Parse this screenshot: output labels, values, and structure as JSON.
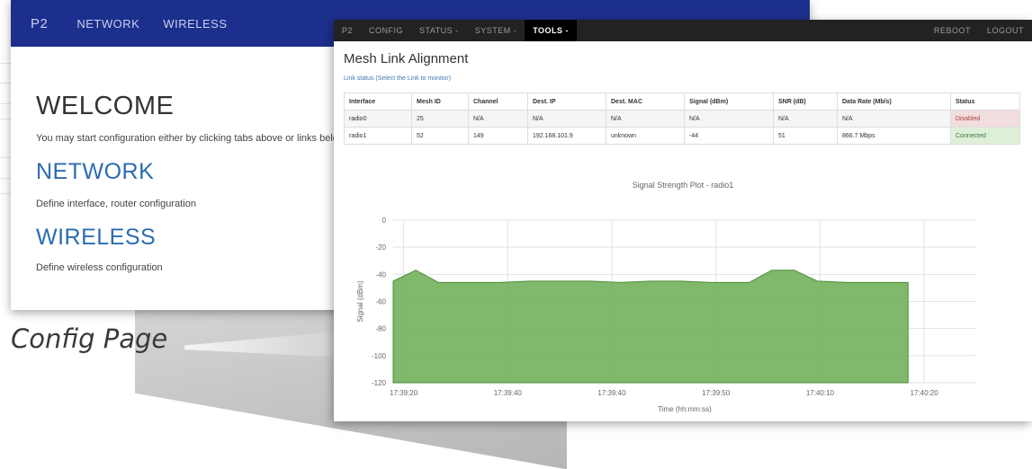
{
  "caption": "Config Page",
  "config_window": {
    "nav": {
      "brand": "P2",
      "items": [
        "NETWORK",
        "WIRELESS"
      ]
    },
    "welcome_title": "WELCOME",
    "welcome_text": "You may start configuration either by clicking tabs above or links below",
    "sections": [
      {
        "title": "NETWORK",
        "text": "Define interface, router configuration"
      },
      {
        "title": "WIRELESS",
        "text": "Define wireless configuration"
      }
    ]
  },
  "tools_window": {
    "nav": {
      "brand": "P2",
      "items": [
        "CONFIG",
        "STATUS -",
        "SYSTEM -",
        "TOOLS -"
      ],
      "active": "TOOLS -",
      "right_items": [
        "REBOOT",
        "LOGOUT"
      ]
    },
    "title": "Mesh Link Alignment",
    "hint": "Link status (Select the Link to monitor)",
    "table": {
      "headers": [
        "Interface",
        "Mesh ID",
        "Channel",
        "Dest. IP",
        "Dest. MAC",
        "Signal (dBm)",
        "SNR (dB)",
        "Data Rate (Mb/s)",
        "Status"
      ],
      "rows": [
        [
          "radio0",
          "25",
          "N/A",
          "N/A",
          "N/A",
          "N/A",
          "N/A",
          "N/A",
          "Disabled"
        ],
        [
          "radio1",
          "52",
          "149",
          "192.168.101.9",
          "unknown",
          "-44",
          "51",
          "866.7 Mbps",
          "Connected"
        ]
      ]
    },
    "colors": {
      "disabled": "#f2dede",
      "connected": "#dff0d8",
      "area": "#72b05c"
    }
  },
  "chart_data": {
    "type": "area",
    "title": "Signal Strength Plot - radio1",
    "xlabel": "Time (hh:mm:ss)",
    "ylabel": "Signal (dBm)",
    "ylim": [
      -120,
      0
    ],
    "yticks": [
      0,
      -20,
      -40,
      -60,
      -80,
      -100,
      -120
    ],
    "xticks": [
      "17:39:20",
      "17:39:40",
      "17:39:40",
      "17:39:50",
      "17:40:10",
      "17:40:20"
    ],
    "x_range_seconds": [
      0,
      77
    ],
    "series": [
      {
        "name": "radio1",
        "x": [
          0,
          3,
          6,
          10,
          14,
          18,
          22,
          26,
          30,
          34,
          38,
          42,
          44,
          47,
          50,
          53,
          56,
          60,
          64,
          68
        ],
        "values": [
          -45,
          -37,
          -46,
          -46,
          -46,
          -45,
          -45,
          -45,
          -46,
          -45,
          -45,
          -46,
          -46,
          -46,
          -37,
          -37,
          -45,
          -46,
          -46,
          -46
        ]
      }
    ]
  }
}
